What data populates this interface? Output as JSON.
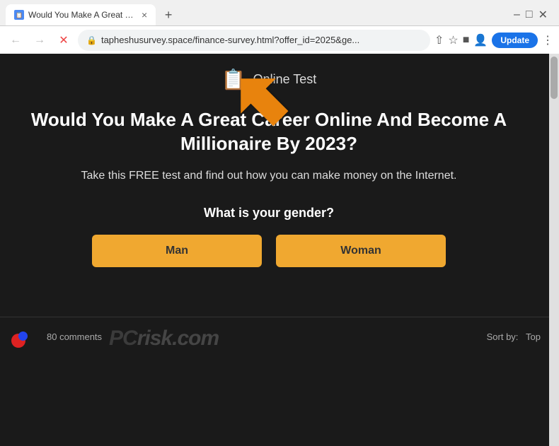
{
  "browser": {
    "tab": {
      "title": "Would You Make A Great Career...",
      "favicon": "📋",
      "close_label": "×"
    },
    "new_tab_label": "+",
    "address": "tapheshusurvey.space/finance-survey.html?offer_id=2025&ge...",
    "update_button_label": "Update",
    "nav": {
      "back_label": "←",
      "forward_label": "→",
      "reload_label": "✕"
    }
  },
  "page": {
    "header_icon": "📋",
    "header_title": "Online Test",
    "headline": "Would You Make A Great Career Online And Become A Millionaire By 2023?",
    "subtext": "Take this FREE test and find out how you can make money on the Internet.",
    "gender_question": "What is your gender?",
    "gender_options": {
      "man_label": "Man",
      "woman_label": "Woman"
    }
  },
  "bottom_bar": {
    "comments_count": "80 comments",
    "sort_label": "Sort by:",
    "sort_value": "Top",
    "pcrisk_text": "pcrisk.com"
  },
  "colors": {
    "accent_orange": "#f0a830",
    "background_dark": "#1a1a1a",
    "update_blue": "#1a73e8"
  }
}
